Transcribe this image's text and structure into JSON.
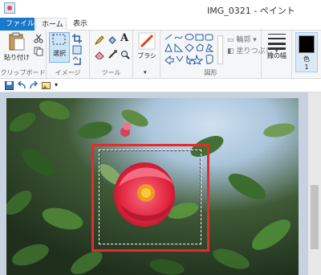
{
  "window": {
    "title": "IMG_0321 - ペイント"
  },
  "tabs": [
    {
      "label": "ファイル"
    },
    {
      "label": "ホーム"
    },
    {
      "label": "表示"
    }
  ],
  "ribbon": {
    "clipboard": {
      "paste_label": "貼り付け",
      "group_label": "クリップボード"
    },
    "image": {
      "select_label": "選択",
      "group_label": "イメージ"
    },
    "tools": {
      "group_label": "ツール"
    },
    "brushes": {
      "label": "ブラシ"
    },
    "shapes": {
      "outline_label": "輪郭",
      "fill_label": "塗りつぶし",
      "group_label": "図形"
    },
    "size": {
      "label": "線の幅"
    },
    "color1": {
      "label": "色",
      "index": "1"
    }
  },
  "colors": {
    "accent": "#1979ca",
    "highlight_box": "#e52b2b",
    "ribbon_bg": "#f5f6f7"
  }
}
